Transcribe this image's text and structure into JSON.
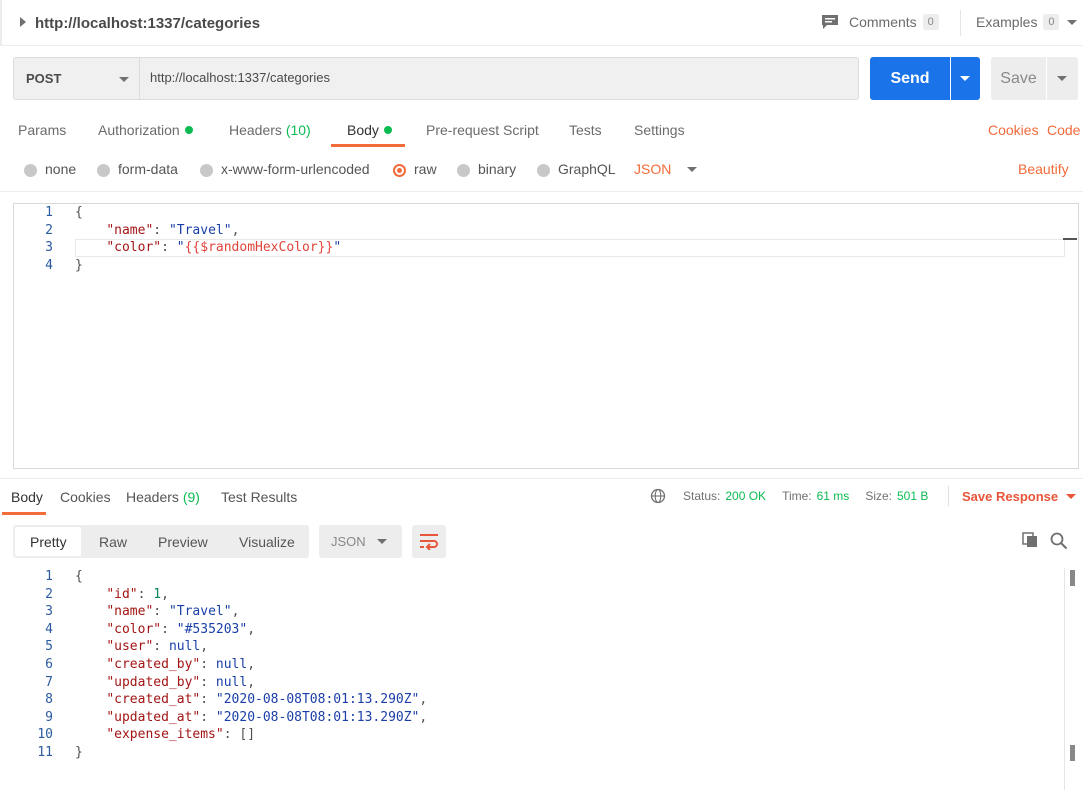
{
  "header": {
    "title": "http://localhost:1337/categories",
    "comments_label": "Comments",
    "comments_count": "0",
    "examples_label": "Examples",
    "examples_count": "0"
  },
  "request": {
    "method": "POST",
    "url": "http://localhost:1337/categories",
    "send_label": "Send",
    "save_label": "Save"
  },
  "tabs": {
    "params": "Params",
    "authorization": "Authorization",
    "headers": "Headers",
    "headers_count": "(10)",
    "body": "Body",
    "prerequest": "Pre-request Script",
    "tests": "Tests",
    "settings": "Settings",
    "cookies": "Cookies",
    "code": "Code"
  },
  "body_options": {
    "none": "none",
    "form_data": "form-data",
    "urlencoded": "x-www-form-urlencoded",
    "raw": "raw",
    "binary": "binary",
    "graphql": "GraphQL",
    "format": "JSON",
    "beautify": "Beautify"
  },
  "request_body": {
    "line_numbers": [
      "1",
      "2",
      "3",
      "4"
    ],
    "open": "{",
    "name_key": "\"name\"",
    "name_val": "\"Travel\"",
    "color_key": "\"color\"",
    "color_quote": "\"",
    "color_val": "{{$randomHexColor}}",
    "close": "}"
  },
  "response_tabs": {
    "body": "Body",
    "cookies": "Cookies",
    "headers": "Headers",
    "headers_count": "(9)",
    "test_results": "Test Results"
  },
  "response_status": {
    "status_label": "Status:",
    "status_value": "200 OK",
    "time_label": "Time:",
    "time_value": "61 ms",
    "size_label": "Size:",
    "size_value": "501 B",
    "save_response": "Save Response"
  },
  "response_toolbar": {
    "pretty": "Pretty",
    "raw": "Raw",
    "preview": "Preview",
    "visualize": "Visualize",
    "format": "JSON"
  },
  "response_body": {
    "line_numbers": [
      "1",
      "2",
      "3",
      "4",
      "5",
      "6",
      "7",
      "8",
      "9",
      "10",
      "11"
    ],
    "open": "{",
    "id_key": "\"id\"",
    "id_val": "1",
    "name_key": "\"name\"",
    "name_val": "\"Travel\"",
    "color_key": "\"color\"",
    "color_val": "\"#535203\"",
    "user_key": "\"user\"",
    "user_val": "null",
    "created_by_key": "\"created_by\"",
    "created_by_val": "null",
    "updated_by_key": "\"updated_by\"",
    "updated_by_val": "null",
    "created_at_key": "\"created_at\"",
    "created_at_val": "\"2020-08-08T08:01:13.290Z\"",
    "updated_at_key": "\"updated_at\"",
    "updated_at_val": "\"2020-08-08T08:01:13.290Z\"",
    "expense_items_key": "\"expense_items\"",
    "expense_items_val": "[]",
    "close": "}"
  },
  "colors": {
    "accent": "#f26b3a",
    "primary": "#1a73e8",
    "success": "#0cbb52"
  }
}
